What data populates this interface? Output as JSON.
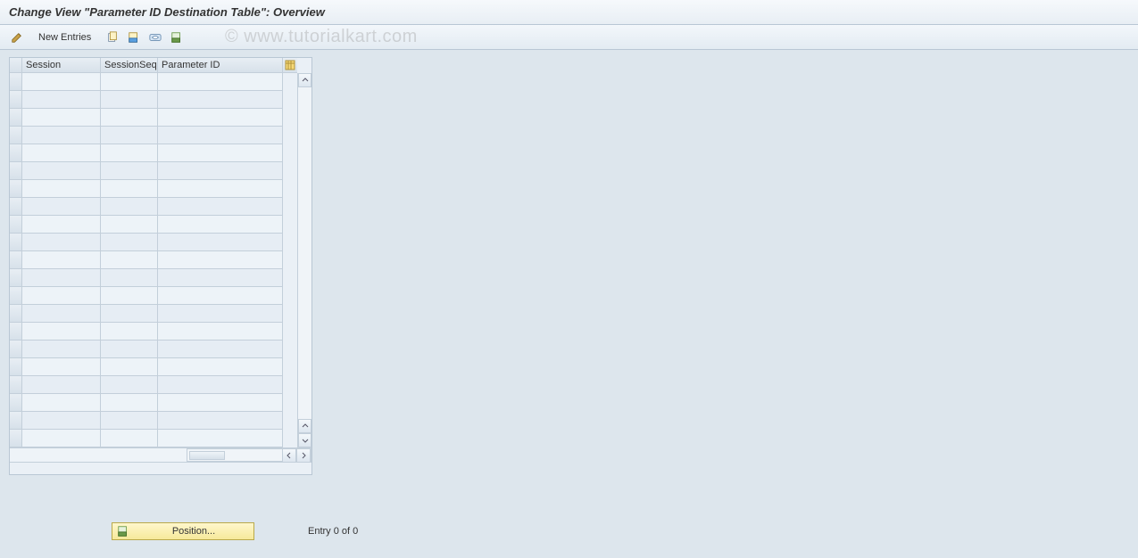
{
  "title": "Change View \"Parameter ID  Destination  Table\": Overview",
  "toolbar": {
    "new_entries_label": "New Entries"
  },
  "watermark": "© www.tutorialkart.com",
  "grid": {
    "columns": {
      "session": "Session",
      "session_seq": "SessionSeq",
      "parameter_id": "Parameter ID"
    },
    "row_count": 21
  },
  "footer": {
    "position_label": "Position...",
    "entry_status": "Entry 0 of 0"
  }
}
